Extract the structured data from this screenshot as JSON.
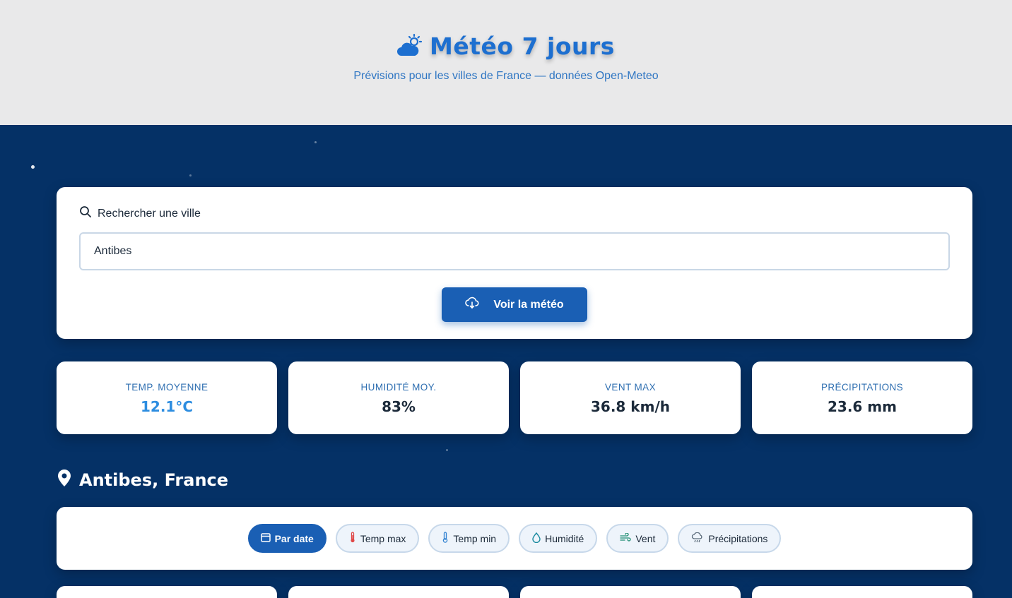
{
  "header": {
    "title": "Météo 7 jours",
    "subtitle": "Prévisions pour les villes de France — données Open-Meteo",
    "title_icon": "partly-cloudy-icon"
  },
  "search": {
    "label": "Rechercher une ville",
    "value": "Antibes",
    "button_label": "Voir la météo"
  },
  "stats": [
    {
      "label": "TEMP. MOYENNE",
      "value": "12.1°C"
    },
    {
      "label": "HUMIDITÉ MOY.",
      "value": "83%"
    },
    {
      "label": "VENT MAX",
      "value": "36.8 km/h"
    },
    {
      "label": "PRÉCIPITATIONS",
      "value": "23.6 mm"
    }
  ],
  "location": {
    "name": "Antibes, France"
  },
  "filters": [
    {
      "label": "Par date",
      "icon": "calendar-icon",
      "active": true
    },
    {
      "label": "Temp max",
      "icon": "thermometer-hot-icon",
      "active": false
    },
    {
      "label": "Temp min",
      "icon": "thermometer-cold-icon",
      "active": false
    },
    {
      "label": "Humidité",
      "icon": "droplet-icon",
      "active": false
    },
    {
      "label": "Vent",
      "icon": "wind-icon",
      "active": false
    },
    {
      "label": "Précipitations",
      "icon": "rain-cloud-icon",
      "active": false
    }
  ],
  "colors": {
    "primary": "#1a5fb4",
    "background": "#053166",
    "header_bg": "#e9e9ea",
    "accent_temp": "#2d8de0"
  }
}
